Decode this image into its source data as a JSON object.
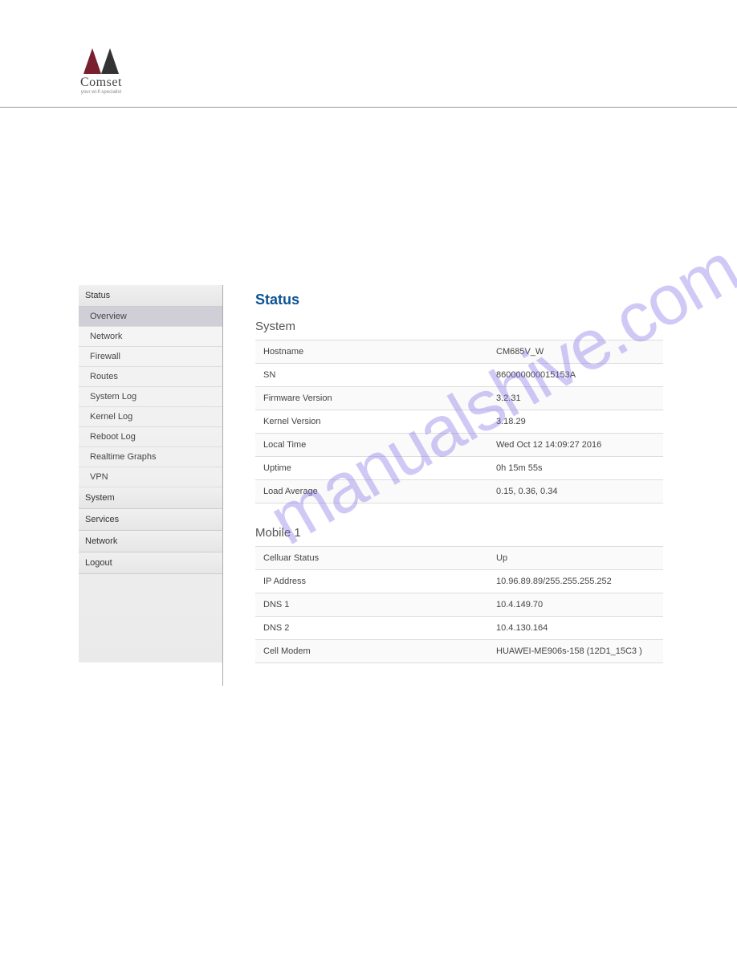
{
  "logo": {
    "brand": "Comset",
    "tagline": "your wi-fi specialist"
  },
  "watermark": "manualshive.com",
  "sidebar": {
    "sections": [
      {
        "label": "Status",
        "expanded": true,
        "items": [
          {
            "label": "Overview",
            "active": true
          },
          {
            "label": "Network",
            "active": false
          },
          {
            "label": "Firewall",
            "active": false
          },
          {
            "label": "Routes",
            "active": false
          },
          {
            "label": "System Log",
            "active": false
          },
          {
            "label": "Kernel Log",
            "active": false
          },
          {
            "label": "Reboot Log",
            "active": false
          },
          {
            "label": "Realtime Graphs",
            "active": false
          },
          {
            "label": "VPN",
            "active": false
          }
        ]
      },
      {
        "label": "System",
        "expanded": false,
        "items": []
      },
      {
        "label": "Services",
        "expanded": false,
        "items": []
      },
      {
        "label": "Network",
        "expanded": false,
        "items": []
      },
      {
        "label": "Logout",
        "expanded": false,
        "items": []
      }
    ]
  },
  "main": {
    "title": "Status",
    "sections": [
      {
        "heading": "System",
        "rows": [
          {
            "label": "Hostname",
            "value": "CM685V_W"
          },
          {
            "label": "SN",
            "value": "860000000015153A"
          },
          {
            "label": "Firmware Version",
            "value": "3.2.31"
          },
          {
            "label": "Kernel Version",
            "value": "3.18.29"
          },
          {
            "label": "Local Time",
            "value": "Wed Oct 12 14:09:27 2016"
          },
          {
            "label": "Uptime",
            "value": "0h 15m 55s"
          },
          {
            "label": "Load Average",
            "value": "0.15, 0.36, 0.34"
          }
        ]
      },
      {
        "heading": "Mobile 1",
        "rows": [
          {
            "label": "Celluar Status",
            "value": "Up"
          },
          {
            "label": "IP Address",
            "value": "10.96.89.89/255.255.255.252"
          },
          {
            "label": "DNS 1",
            "value": "10.4.149.70"
          },
          {
            "label": "DNS 2",
            "value": "10.4.130.164"
          },
          {
            "label": "Cell Modem",
            "value": "HUAWEI-ME906s-158 (12D1_15C3 )"
          }
        ]
      }
    ]
  }
}
